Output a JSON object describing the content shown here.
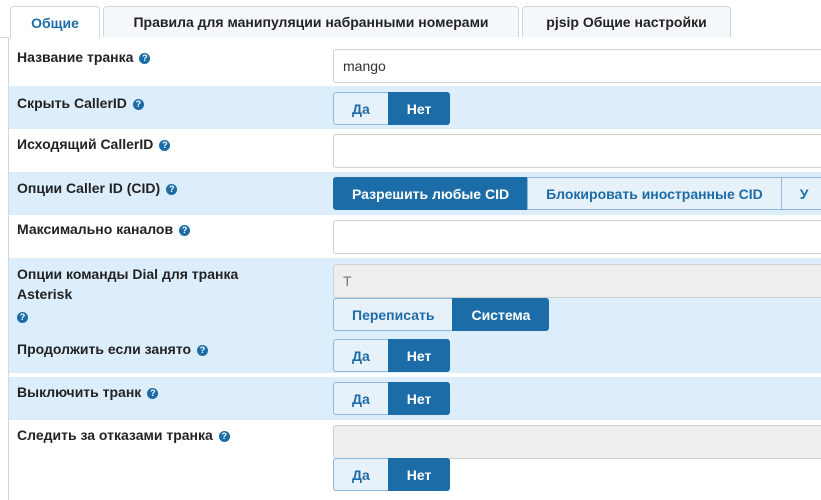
{
  "tabs": [
    {
      "label": "Общие",
      "active": true
    },
    {
      "label": "Правила для манипуляции набранными номерами",
      "active": false
    },
    {
      "label": "pjsip Общие настройки",
      "active": false
    }
  ],
  "colors": {
    "accent": "#1c6ca8",
    "row_shade": "#dceefb",
    "button_off": "#e7f1fa"
  },
  "fields": {
    "trunk_name": {
      "label": "Название транка",
      "value": "mango"
    },
    "hide_callerid": {
      "label": "Скрыть CallerID",
      "yes": "Да",
      "no": "Нет",
      "selected": "no"
    },
    "outbound_callerid": {
      "label": "Исходящий CallerID",
      "value": ""
    },
    "cid_options": {
      "label": "Опции Caller ID (CID)",
      "options": [
        "Разрешить любые CID",
        "Блокировать иностранные CID",
        "У"
      ],
      "selected": 0
    },
    "max_channels": {
      "label": "Максимально каналов",
      "value": ""
    },
    "dial_options": {
      "label_line1": "Опции команды Dial для транка",
      "label_line2": "Asterisk",
      "value": "T",
      "override": "Переписать",
      "system": "Система",
      "selected": "system"
    },
    "continue_if_busy": {
      "label": "Продолжить если занято",
      "yes": "Да",
      "no": "Нет",
      "selected": "no"
    },
    "disable_trunk": {
      "label": "Выключить транк",
      "yes": "Да",
      "no": "Нет",
      "selected": "no"
    },
    "monitor_failures": {
      "label": "Следить за отказами транка",
      "value": "",
      "yes": "Да",
      "no": "Нет",
      "selected": "no"
    }
  },
  "help_glyph": "?"
}
